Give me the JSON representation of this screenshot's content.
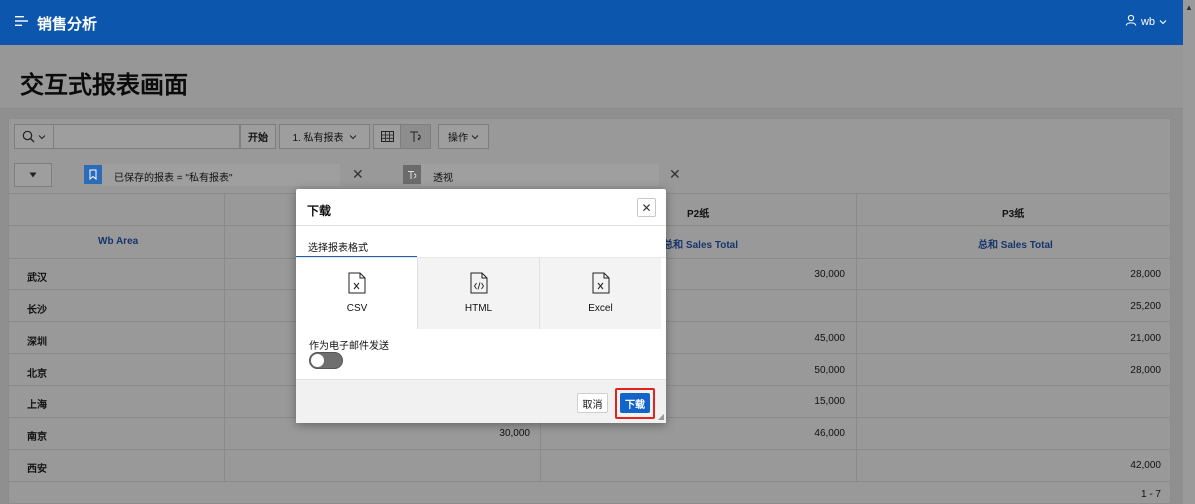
{
  "header": {
    "title": "销售分析",
    "user": "wb"
  },
  "page": {
    "title": "交互式报表画面"
  },
  "toolbar": {
    "search_value": "",
    "go_label": "开始",
    "report_select": "1. 私有报表",
    "actions_label": "操作"
  },
  "filters": {
    "saved_report": "已保存的报表 = \"私有报表\"",
    "pivot": "透视"
  },
  "table": {
    "pivot_headers": [
      "P2纸",
      "P3纸"
    ],
    "row_header": "Wb Area",
    "sum_header": "总和 Sales Total",
    "sum_header_partial": "总和 Sales Total",
    "rows": [
      {
        "area": "武汉",
        "p1": "",
        "p2": "30,000",
        "p3": "28,000"
      },
      {
        "area": "长沙",
        "p1": "",
        "p2": "",
        "p3": "25,200"
      },
      {
        "area": "深圳",
        "p1": "",
        "p2": "45,000",
        "p3": "21,000"
      },
      {
        "area": "北京",
        "p1": "",
        "p2": "50,000",
        "p3": "28,000"
      },
      {
        "area": "上海",
        "p1": "",
        "p2": "15,000",
        "p3": ""
      },
      {
        "area": "南京",
        "p1": "30,000",
        "p2": "46,000",
        "p3": ""
      },
      {
        "area": "西安",
        "p1": "",
        "p2": "",
        "p3": "42,000"
      }
    ],
    "pagination": "1 - 7"
  },
  "dialog": {
    "title": "下载",
    "tab_label": "选择报表格式",
    "formats": [
      {
        "label": "CSV",
        "icon": "file-csv-icon"
      },
      {
        "label": "HTML",
        "icon": "file-code-icon"
      },
      {
        "label": "Excel",
        "icon": "file-excel-icon"
      }
    ],
    "email_label": "作为电子邮件发送",
    "email_toggle": "off",
    "cancel_label": "取消",
    "download_label": "下载"
  },
  "colors": {
    "topbar": "#0c57ad",
    "primary_button": "#1264c9",
    "highlight": "#e3231b",
    "tab_underline": "#1a5fb4"
  }
}
